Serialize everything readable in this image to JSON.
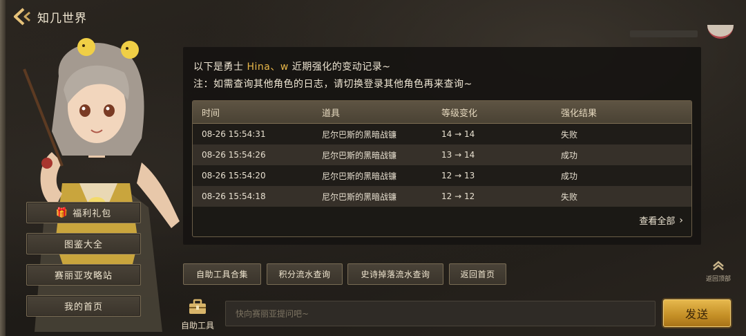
{
  "header": {
    "title": "知几世界"
  },
  "left_menu": {
    "items": [
      {
        "label": "福利礼包",
        "icon": "gift-icon"
      },
      {
        "label": "图鉴大全"
      },
      {
        "label": "赛丽亚攻略站"
      },
      {
        "label": "我的首页"
      }
    ]
  },
  "panel": {
    "intro_prefix": "以下是勇士",
    "hero_name": "Hina、w",
    "intro_suffix": "近期强化的变动记录~",
    "note": "注：如需查询其他角色的日志，请切换登录其他角色再来查询~",
    "table": {
      "headers": [
        "时间",
        "道具",
        "等级变化",
        "强化结果"
      ],
      "rows": [
        {
          "time": "08-26 15:54:31",
          "item": "尼尔巴斯的黑暗战镰",
          "level": "14 → 14",
          "result": "失败"
        },
        {
          "time": "08-26 15:54:26",
          "item": "尼尔巴斯的黑暗战镰",
          "level": "13 → 14",
          "result": "成功"
        },
        {
          "time": "08-26 15:54:20",
          "item": "尼尔巴斯的黑暗战镰",
          "level": "12 → 13",
          "result": "成功"
        },
        {
          "time": "08-26 15:54:18",
          "item": "尼尔巴斯的黑暗战镰",
          "level": "12 → 12",
          "result": "失败"
        }
      ]
    },
    "view_all": "查看全部"
  },
  "tools": {
    "buttons": [
      "自助工具合集",
      "积分流水查询",
      "史诗掉落流水查询",
      "返回首页"
    ],
    "scroll_top_label": "返回顶部"
  },
  "bottom": {
    "tool_label": "自助工具",
    "input_placeholder": "快向赛丽亚提问吧~",
    "send_label": "发送"
  },
  "colors": {
    "accent_gold": "#e9b84a",
    "send_button": "#d4a033",
    "panel_bg": "#161411"
  }
}
